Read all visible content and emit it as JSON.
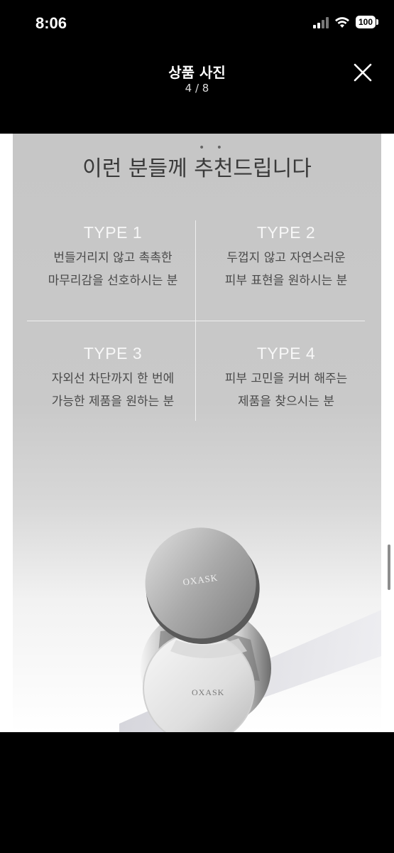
{
  "status_bar": {
    "time": "8:06",
    "battery": "100"
  },
  "header": {
    "title": "상품 사진",
    "counter": "4 / 8",
    "close_icon": "close-icon"
  },
  "photo": {
    "heading": "이런 분들께 추천드립니다",
    "heading_dots": "• •",
    "types": [
      {
        "title": "TYPE 1",
        "lines": [
          "번들거리지 않고 촉촉한",
          "마무리감을 선호하시는 분"
        ]
      },
      {
        "title": "TYPE 2",
        "lines": [
          "두껍지 않고 자연스러운",
          "피부 표현을 원하시는 분"
        ]
      },
      {
        "title": "TYPE 3",
        "lines": [
          "자외선 차단까지 한 번에",
          "가능한 제품을 원하는 분"
        ]
      },
      {
        "title": "TYPE 4",
        "lines": [
          "피부 고민을 커버 해주는",
          "제품을 찾으시는 분"
        ]
      }
    ],
    "product_brand_top": "OXASK",
    "product_brand_bottom": "OXASK"
  }
}
